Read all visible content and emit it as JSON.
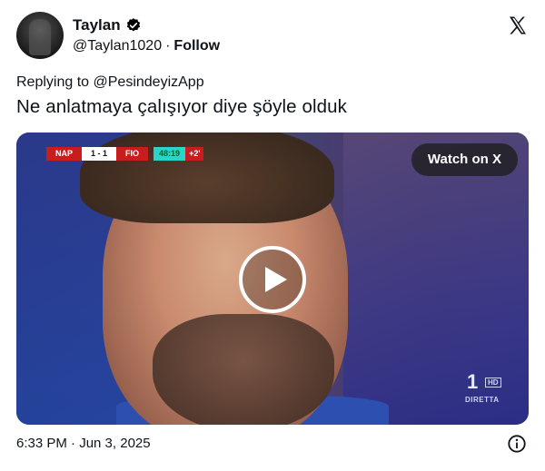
{
  "author": {
    "display_name": "Taylan",
    "handle": "@Taylan1020",
    "separator": "·",
    "follow_label": "Follow"
  },
  "reply": {
    "prefix": "Replying to",
    "mention": "@PesindeyizApp"
  },
  "tweet": {
    "text": "Ne anlatmaya çalışıyor diye şöyle olduk"
  },
  "video": {
    "watch_label": "Watch on X",
    "scoreboard": {
      "home": "NAP",
      "score": "1 - 1",
      "away": "FIO",
      "clock": "48:19",
      "added": "+2'"
    },
    "broadcaster": {
      "logo": "1",
      "hd": "HD",
      "status": "DIRETTA"
    }
  },
  "timestamp": "6:33 PM · Jun 3, 2025",
  "icons": {
    "verified": "verified-badge-icon",
    "brand": "x-logo-icon",
    "play": "play-icon",
    "info": "info-icon"
  },
  "colors": {
    "verified_fill": "#000000",
    "text_primary": "#0f1419",
    "scoreboard_red": "#c81d1d",
    "scoreboard_teal": "#2ad4c8"
  }
}
